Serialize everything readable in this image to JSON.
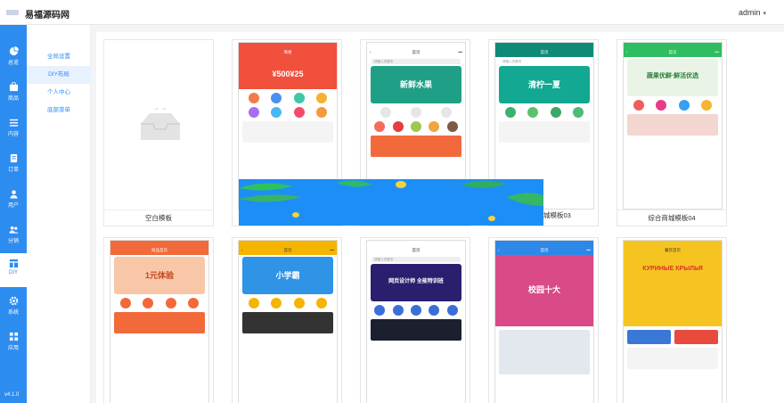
{
  "header": {
    "brand": "易福源码网",
    "user": "admin"
  },
  "sidebar": {
    "items": [
      {
        "label": "总览",
        "icon": "pie-chart-icon"
      },
      {
        "label": "商品",
        "icon": "shopping-bag-icon"
      },
      {
        "label": "内容",
        "icon": "list-icon"
      },
      {
        "label": "订单",
        "icon": "document-icon"
      },
      {
        "label": "用户",
        "icon": "user-icon"
      },
      {
        "label": "分销",
        "icon": "users-icon"
      },
      {
        "label": "DIY",
        "icon": "layout-icon"
      },
      {
        "label": "系统",
        "icon": "gear-icon"
      },
      {
        "label": "应用",
        "icon": "apps-grid-icon"
      }
    ],
    "version": "v4.1.0"
  },
  "submenu": {
    "items": [
      "全局设置",
      "DIY布局",
      "个人中心",
      "底部菜单"
    ],
    "active": "DIY布局"
  },
  "templates": {
    "blank_label": "空白模板",
    "row1_label_partial": "城模板03",
    "row1_label_last": "综合商城模板04",
    "cards": [
      {
        "nav_title": "简易",
        "banner_text": "¥500¥25",
        "banner_color": "#f0503c"
      },
      {
        "nav_title": "首页",
        "search": "请输入关键词",
        "banner_text": "新鲜水果",
        "banner_color": "#1fa086"
      },
      {
        "nav_title": "首页",
        "search": "请输入关键词",
        "banner_text": "清柠一夏",
        "banner_color": "#0f8a78"
      },
      {
        "nav_title": "首页",
        "banner_text": "蔬果优鲜·鲜活优选",
        "banner_color": "#2ebd60"
      },
      {
        "nav_title": "商品首页",
        "banner_text": "1元体验",
        "banner_color": "#f26a3b"
      },
      {
        "nav_title": "首页",
        "banner_text": "小学霸",
        "banner_color": "#f5b400"
      },
      {
        "nav_title": "首页",
        "search": "请输入关键词",
        "banner_text": "网页设计师 全能特训班",
        "banner_color": "#2a1f6e"
      },
      {
        "nav_title": "首页",
        "banner_text": "校园十大",
        "banner_color": "#2e88e8"
      },
      {
        "nav_title": "餐饮首页",
        "banner_text": "КУРИНЫЕ КРЫЛЬЯ",
        "banner_color": "#f6c421"
      }
    ]
  }
}
